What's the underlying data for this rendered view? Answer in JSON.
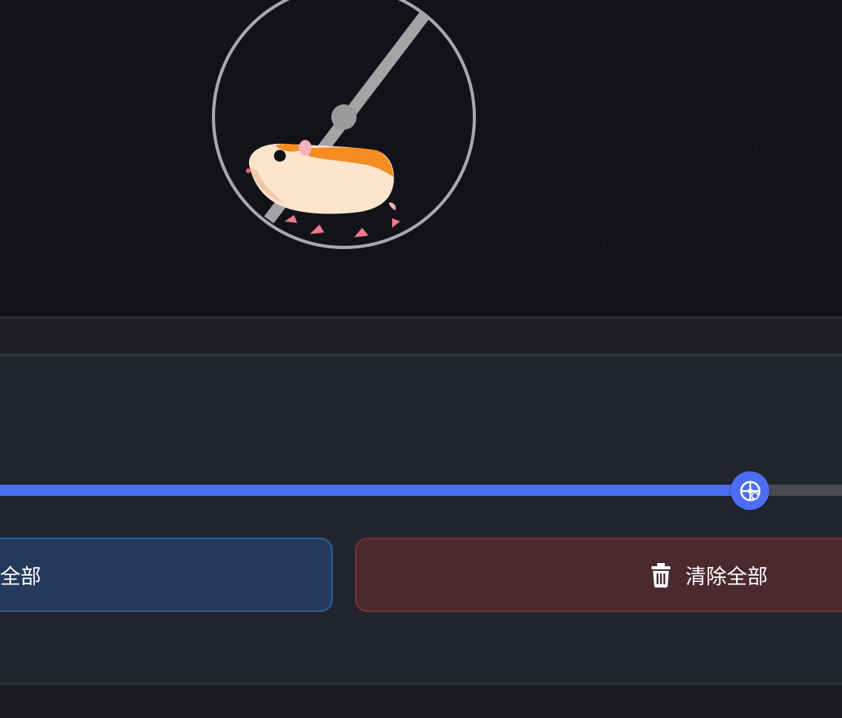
{
  "slider": {
    "value_fraction": 0.891,
    "fill_color": "#4c6ef5",
    "track_color": "#4a4c52",
    "thumb_icon": "wheel-icon"
  },
  "buttons": {
    "select_all_label": "全部",
    "clear_all_label": "清除全部",
    "clear_icon": "trash-icon"
  },
  "colors": {
    "stage_bg": "#121318",
    "panel_bg": "#22252d",
    "select_bg": "#243a5b",
    "select_border": "#2a5f9e",
    "clear_bg": "#4a2930",
    "clear_border": "#7e2d38"
  },
  "stage": {
    "illustration": "hamster-wheel-icon"
  }
}
